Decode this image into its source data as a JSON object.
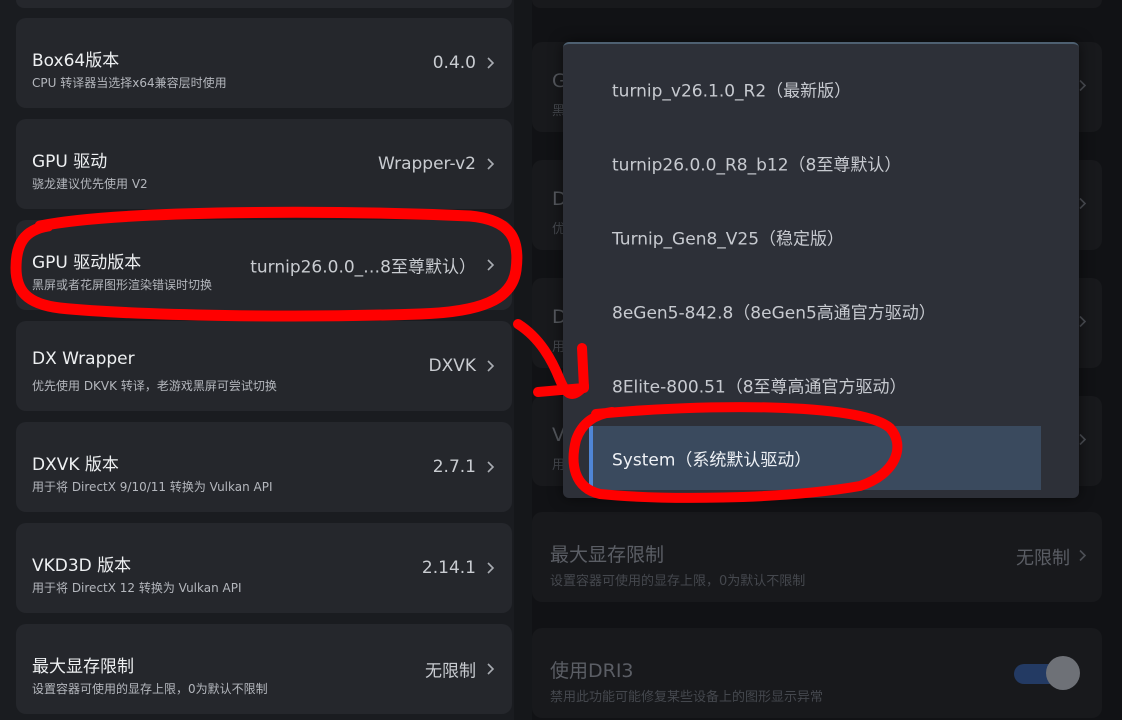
{
  "left_settings": [
    {
      "title": "Box64版本",
      "subtitle": "CPU 转译器当选择x64兼容层时使用",
      "value": "0.4.0"
    },
    {
      "title": "GPU 驱动",
      "subtitle": "骁龙建议优先使用 V2",
      "value": "Wrapper-v2"
    },
    {
      "title": "GPU 驱动版本",
      "subtitle": "黑屏或者花屏图形渲染错误时切换",
      "value": "turnip26.0.0_…8至尊默认）"
    },
    {
      "title": "DX Wrapper",
      "subtitle": "优先使用 DKVK 转译，老游戏黑屏可尝试切换",
      "value": "DXVK"
    },
    {
      "title": "DXVK 版本",
      "subtitle": "用于将 DirectX 9/10/11 转换为 Vulkan API",
      "value": "2.7.1"
    },
    {
      "title": "VKD3D 版本",
      "subtitle": "用于将 DirectX 12 转换为 Vulkan API",
      "value": "2.14.1"
    },
    {
      "title": "最大显存限制",
      "subtitle": "设置容器可使用的显存上限，0为默认不限制",
      "value": "无限制"
    }
  ],
  "right_settings": {
    "partials": [
      "G",
      "D",
      "D",
      "V"
    ],
    "partial_subs": [
      "黑",
      "优",
      "用",
      "用"
    ],
    "vram": {
      "title": "最大显存限制",
      "subtitle": "设置容器可使用的显存上限，0为默认不限制",
      "value": "无限制"
    },
    "dri3": {
      "title": "使用DRI3",
      "subtitle": "禁用此功能可能修复某些设备上的图形显示异常",
      "enabled": true
    }
  },
  "driver_dropdown": {
    "options": [
      "turnip_v26.1.0_R2（最新版）",
      "turnip26.0.0_R8_b12（8至尊默认）",
      "Turnip_Gen8_V25（稳定版）",
      "8eGen5-842.8（8eGen5高通官方驱动）",
      "8Elite-800.51（8至尊高通官方驱动）",
      "System（系统默认驱动）"
    ],
    "selected_index": 5
  },
  "colors": {
    "accent": "#4f86d6",
    "annotation": "#ff0000",
    "card_bg": "#25272c"
  }
}
